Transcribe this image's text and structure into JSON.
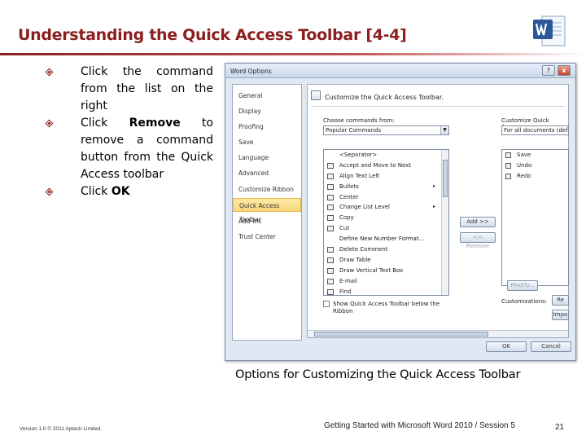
{
  "slide": {
    "title": "Understanding the Quick Access Toolbar [4-4]",
    "bullets": [
      {
        "pre": "Click the command from the list on the right",
        "bold": "",
        "post": ""
      },
      {
        "pre": "Click ",
        "bold": "Remove",
        "post": " to remove a command button from the Quick Access toolbar"
      },
      {
        "pre": "Click ",
        "bold": "OK",
        "post": ""
      }
    ],
    "caption": "Options for Customizing the Quick Access Toolbar",
    "footer_left": "Version 1.0 © 2011 Aptech Limited.",
    "footer_right": "Getting Started with Microsoft Word 2010 / Session 5",
    "page_number": "21",
    "logo_icon": "word-logo-icon",
    "colors": {
      "title": "#8b1e1e",
      "accent": "#2b5797"
    }
  },
  "dialog": {
    "title": "Word Options",
    "help_glyph": "?",
    "close_glyph": "x",
    "nav": [
      "General",
      "Display",
      "Proofing",
      "Save",
      "Language",
      "Advanced",
      "Customize Ribbon",
      "Quick Access Toolbar",
      "Add-Ins",
      "Trust Center"
    ],
    "active_nav": "Quick Access Toolbar",
    "header": "Customize the Quick Access Toolbar.",
    "choose_label": "Choose commands from:",
    "choose_value": "Popular Commands",
    "customize_label": "Customize Quick Access",
    "customize_value": "For all documents (default)",
    "commands": [
      {
        "label": "<Separator>",
        "sub": ""
      },
      {
        "label": "Accept and Move to Next",
        "sub": ""
      },
      {
        "label": "Align Text Left",
        "sub": ""
      },
      {
        "label": "Bullets",
        "sub": "▸"
      },
      {
        "label": "Center",
        "sub": ""
      },
      {
        "label": "Change List Level",
        "sub": "▸"
      },
      {
        "label": "Copy",
        "sub": ""
      },
      {
        "label": "Cut",
        "sub": ""
      },
      {
        "label": "Define New Number Format...",
        "sub": ""
      },
      {
        "label": "Delete Comment",
        "sub": ""
      },
      {
        "label": "Draw Table",
        "sub": ""
      },
      {
        "label": "Draw Vertical Text Box",
        "sub": ""
      },
      {
        "label": "E-mail",
        "sub": ""
      },
      {
        "label": "Find",
        "sub": ""
      }
    ],
    "toolbar_items": [
      "Save",
      "Undo",
      "Redo"
    ],
    "add_button": "Add >>",
    "remove_button": "<< Remove",
    "modify_button": "Modify...",
    "customizations_label": "Customizations:",
    "reset_button": "Re",
    "import_button": "Impo",
    "show_below_label": "Show Quick Access Toolbar below the Ribbon",
    "ok_button": "OK",
    "cancel_button": "Cancel"
  }
}
